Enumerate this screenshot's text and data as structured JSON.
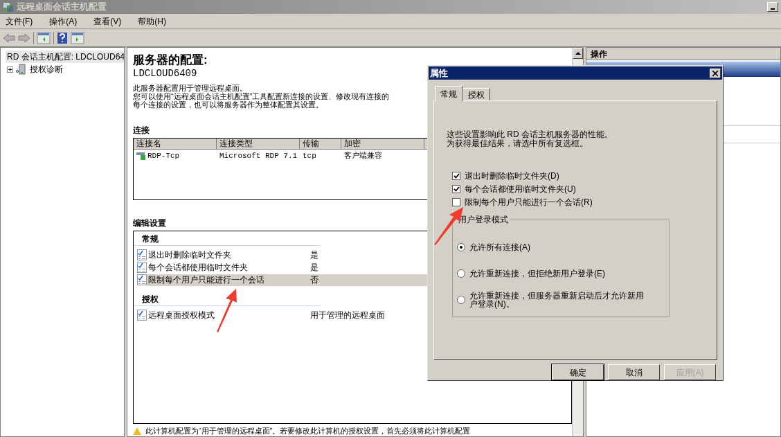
{
  "window": {
    "title": "远程桌面会话主机配置"
  },
  "menu": [
    "文件(F)",
    "操作(A)",
    "查看(V)",
    "帮助(H)"
  ],
  "tree": [
    {
      "label": "RD 会话主机配置: LDCLOUD64",
      "expanded": true,
      "children": [
        {
          "label": "授权诊断",
          "expanded": false
        }
      ]
    }
  ],
  "content": {
    "title": "服务器的配置:",
    "server": "LDCLOUD6409",
    "description": [
      "此服务器配置用于管理远程桌面。",
      "您可以使用“远程桌面会话主机配置”工具配置新连接的设置、修改现有连接的",
      "每个连接的设置，也可以将服务器作为整体配置其设置。"
    ],
    "connections": {
      "heading": "连接",
      "columns": [
        "连接名",
        "连接类型",
        "传输",
        "加密"
      ],
      "rows": [
        [
          "RDP-Tcp",
          "Microsoft RDP 7.1",
          "tcp",
          "客户端兼容"
        ]
      ]
    },
    "edit_settings": {
      "heading": "编辑设置",
      "groups": [
        {
          "title": "常规",
          "items": [
            {
              "name": "退出时删除临时文件夹",
              "value": "是",
              "selected": false
            },
            {
              "name": "每个会话都使用临时文件夹",
              "value": "是",
              "selected": false
            },
            {
              "name": "限制每个用户只能进行一个会话",
              "value": "否",
              "selected": true
            }
          ]
        },
        {
          "title": "授权",
          "items": [
            {
              "name": "远程桌面授权模式",
              "value": "用于管理的远程桌面",
              "selected": false
            }
          ]
        }
      ]
    },
    "warning": "此计算机配置为“用于管理的远程桌面”。若要修改此计算机的授权设置，首先必须将此计算机配置"
  },
  "actions": {
    "title": "操作"
  },
  "dialog": {
    "title": "属性",
    "tabs": [
      {
        "label": "常规",
        "selected": true
      },
      {
        "label": "授权",
        "selected": false
      }
    ],
    "intro": [
      "这些设置影响此 RD 会话主机服务器的性能。",
      "为获得最佳结果，请选中所有复选框。"
    ],
    "checkboxes": [
      {
        "label": "退出时删除临时文件夹(D)",
        "checked": true
      },
      {
        "label": "每个会话都使用临时文件夹(U)",
        "checked": true
      },
      {
        "label": "限制每个用户只能进行一个会话(R)",
        "checked": false
      }
    ],
    "group": {
      "title": "用户登录模式",
      "options": [
        {
          "label": "允许所有连接(A)",
          "selected": true
        },
        {
          "label": "允许重新连接，但拒绝新用户登录(E)",
          "selected": false
        },
        {
          "label": "允许重新连接，但服务器重新启动后才允许新用户登录(N)。",
          "selected": false
        }
      ]
    },
    "buttons": [
      {
        "label": "确定",
        "disabled": false,
        "default": true
      },
      {
        "label": "取消",
        "disabled": false,
        "default": false
      },
      {
        "label": "应用(A)",
        "disabled": true,
        "default": false
      }
    ]
  }
}
